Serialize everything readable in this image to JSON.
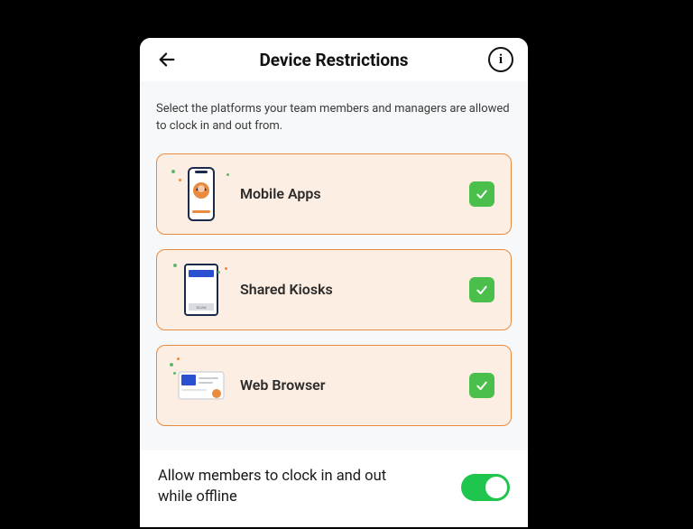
{
  "header": {
    "title": "Device Restrictions"
  },
  "description": "Select the platforms your team members and managers are allowed to clock in and out from.",
  "options": [
    {
      "id": "mobile-apps",
      "label": "Mobile Apps",
      "checked": true
    },
    {
      "id": "shared-kiosks",
      "label": "Shared Kiosks",
      "checked": true
    },
    {
      "id": "web-browser",
      "label": "Web Browser",
      "checked": true
    }
  ],
  "offline": {
    "label": "Allow members to clock in and out while offline",
    "enabled": true
  }
}
